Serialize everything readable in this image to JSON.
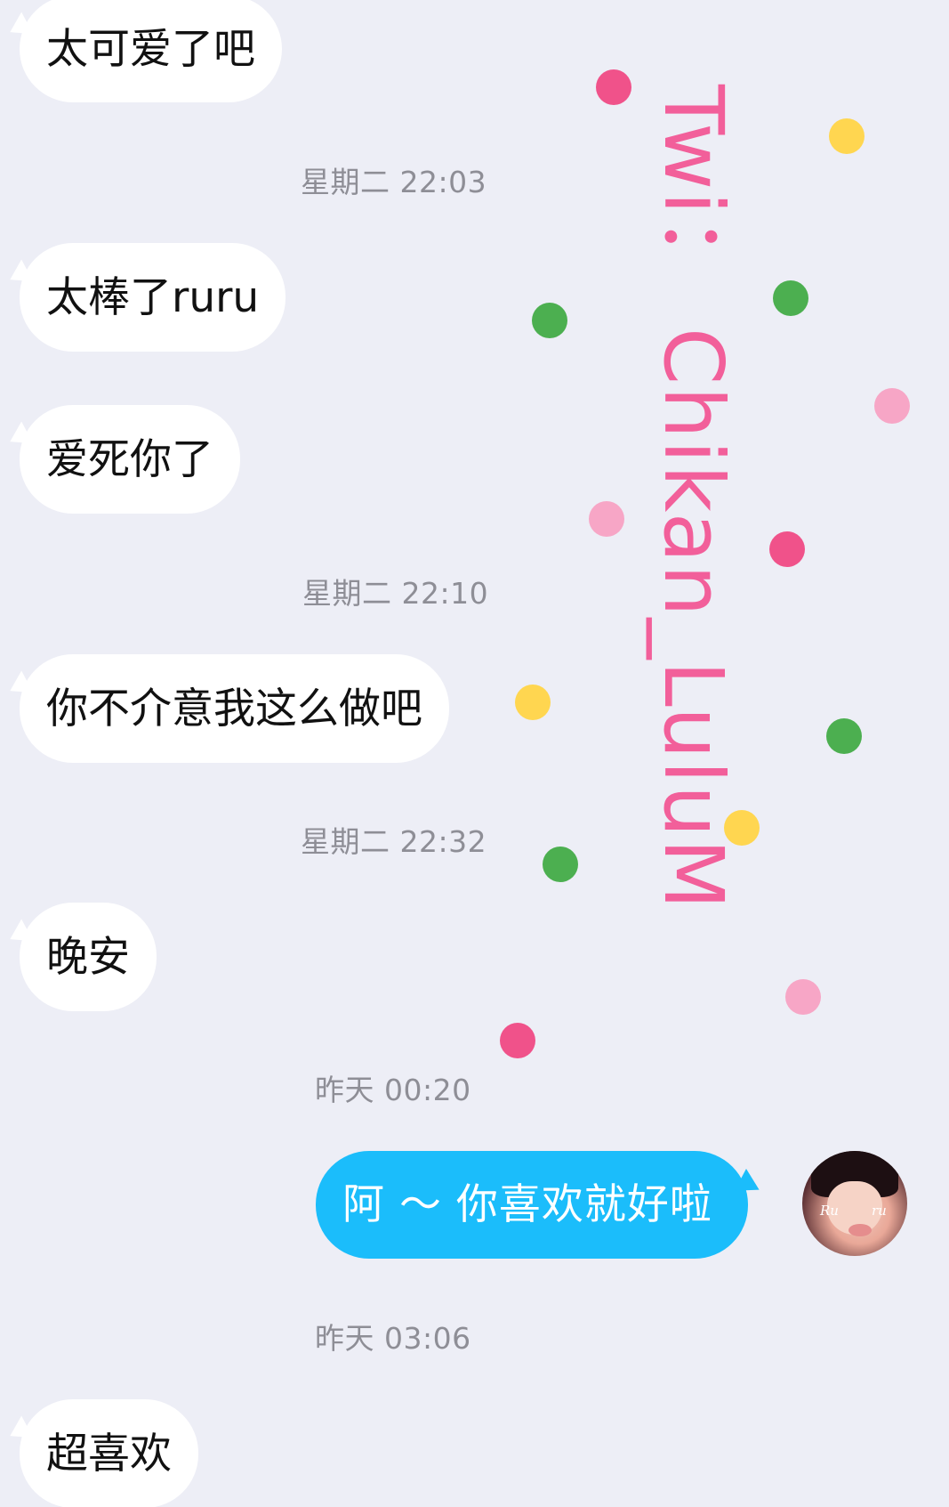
{
  "messages": [
    {
      "type": "in",
      "text": "太可爱了吧"
    },
    {
      "type": "time",
      "text": "星期二 22:03"
    },
    {
      "type": "in",
      "text": "太棒了ruru"
    },
    {
      "type": "in",
      "text": "爱死你了"
    },
    {
      "type": "time",
      "text": "星期二 22:10"
    },
    {
      "type": "in",
      "text": "你不介意我这么做吧"
    },
    {
      "type": "time",
      "text": "星期二 22:32"
    },
    {
      "type": "in",
      "text": "晚安"
    },
    {
      "type": "time",
      "text": "昨天 00:20"
    },
    {
      "type": "out",
      "text": "阿 ～ 你喜欢就好啦"
    },
    {
      "type": "time",
      "text": "昨天 03:06"
    },
    {
      "type": "in",
      "text": "超喜欢"
    }
  ],
  "avatar": {
    "tag_left": "Ru",
    "tag_right": "ru"
  },
  "watermark": {
    "text": "Twi： Chikan_LuluM",
    "color": "#F25F9A"
  },
  "colors": {
    "background": "#EDEEF6",
    "incoming_bubble": "#FFFFFF",
    "outgoing_bubble": "#1BBDFB",
    "timestamp": "#8E8E96",
    "dot_pink": "#F0528A",
    "dot_light_pink": "#F7A6C6",
    "dot_yellow": "#FFD650",
    "dot_green": "#4CAF50"
  }
}
